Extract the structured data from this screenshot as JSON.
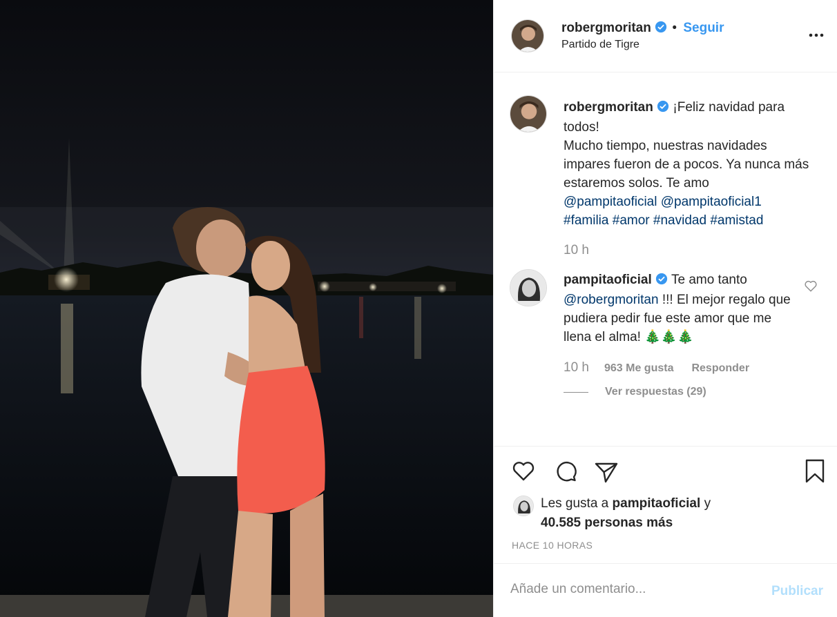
{
  "header": {
    "username": "robergmoritan",
    "separator": "•",
    "follow_label": "Seguir",
    "location": "Partido de Tigre",
    "more_icon": "more-horizontal-icon"
  },
  "caption": {
    "username": "robergmoritan",
    "line1": "¡Feliz navidad para todos!",
    "line2": "Mucho tiempo, nuestras navidades impares fueron de a pocos. Ya nunca más estaremos solos. Te amo",
    "mention1": "@pampitaoficial",
    "mention2": "@pampitaoficial1",
    "tag1": "#familia",
    "tag2": "#amor",
    "tag3": "#navidad",
    "tag4": "#amistad",
    "time": "10 h"
  },
  "comment": {
    "username": "pampitaoficial",
    "text_before": "Te amo tanto",
    "mention": "@robergmoritan",
    "text_after": "!!! El mejor regalo que pudiera pedir fue este amor que me llena el alma! 🎄🎄🎄",
    "time": "10 h",
    "likes": "963 Me gusta",
    "reply_label": "Responder",
    "view_replies": "Ver respuestas (29)"
  },
  "actions": {
    "like_icon": "heart-icon",
    "comment_icon": "comment-bubble-icon",
    "share_icon": "paper-plane-icon",
    "save_icon": "bookmark-icon"
  },
  "likes": {
    "prefix": "Les gusta a",
    "user": "pampitaoficial",
    "connector": "y",
    "others": "40.585 personas más"
  },
  "timestamp": "HACE 10 HORAS",
  "add_comment": {
    "placeholder": "Añade un comentario...",
    "publish_label": "Publicar"
  },
  "colors": {
    "link_blue": "#3897f0",
    "mention_blue": "#00376b",
    "secondary_gray": "#8e8e8e",
    "publish_disabled": "#b2dffc"
  }
}
